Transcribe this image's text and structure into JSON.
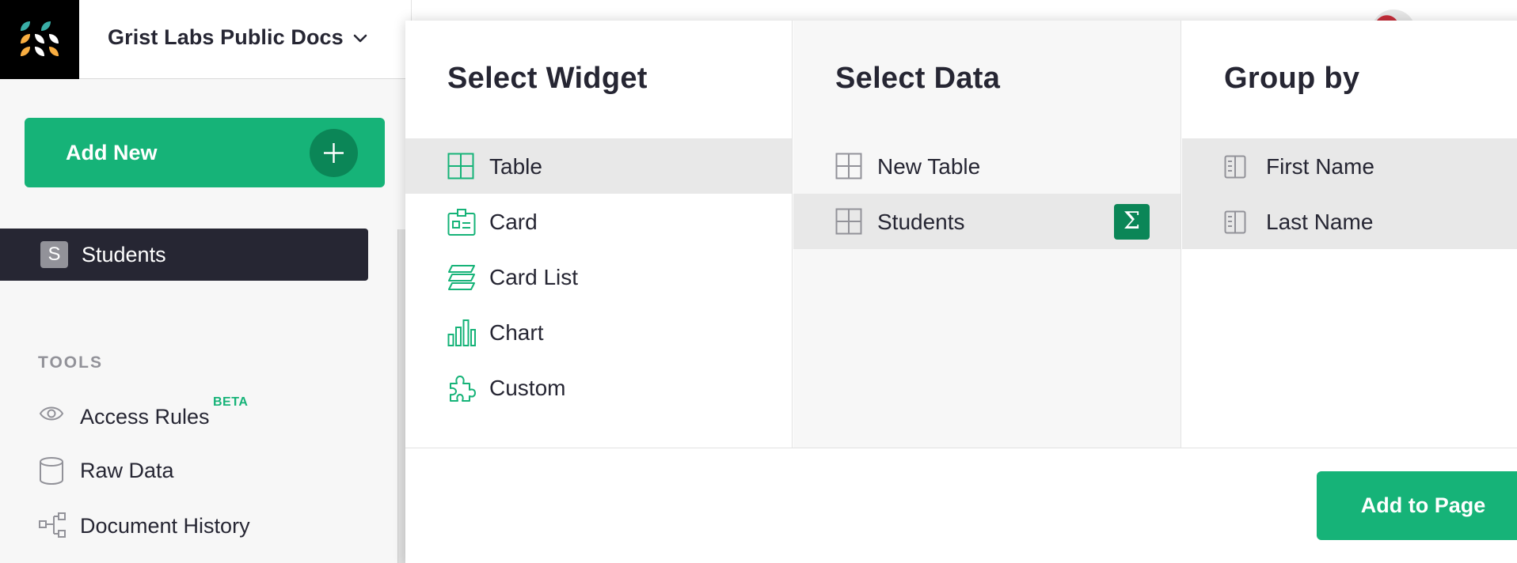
{
  "header": {
    "org_name": "Grist Labs Public Docs"
  },
  "sidebar": {
    "add_new_label": "Add New",
    "pages": [
      {
        "initial": "S",
        "label": "Students",
        "selected": true
      }
    ],
    "tools_header": "TOOLS",
    "tools": [
      {
        "label": "Access Rules",
        "badge": "BETA",
        "icon": "eye-icon"
      },
      {
        "label": "Raw Data",
        "icon": "database-icon"
      },
      {
        "label": "Document History",
        "icon": "history-icon"
      }
    ]
  },
  "picker": {
    "widget_title": "Select Widget",
    "widgets": [
      {
        "label": "Table",
        "icon": "table-icon",
        "selected": true
      },
      {
        "label": "Card",
        "icon": "card-icon"
      },
      {
        "label": "Card List",
        "icon": "card-list-icon"
      },
      {
        "label": "Chart",
        "icon": "chart-icon"
      },
      {
        "label": "Custom",
        "icon": "puzzle-icon"
      }
    ],
    "data_title": "Select Data",
    "data": [
      {
        "label": "New Table",
        "icon": "table-icon"
      },
      {
        "label": "Students",
        "icon": "table-icon",
        "selected": true,
        "summary_symbol": "Σ"
      }
    ],
    "group_title": "Group by",
    "group_fields": [
      {
        "label": "First Name",
        "icon": "field-icon"
      },
      {
        "label": "Last Name",
        "icon": "field-icon"
      }
    ],
    "add_to_page_label": "Add to Page"
  },
  "colors": {
    "accent": "#16b378",
    "accent_dark": "#0b8657",
    "dark_nav": "#262633",
    "muted_text": "#929299",
    "selected_row": "#e8e8e8"
  }
}
